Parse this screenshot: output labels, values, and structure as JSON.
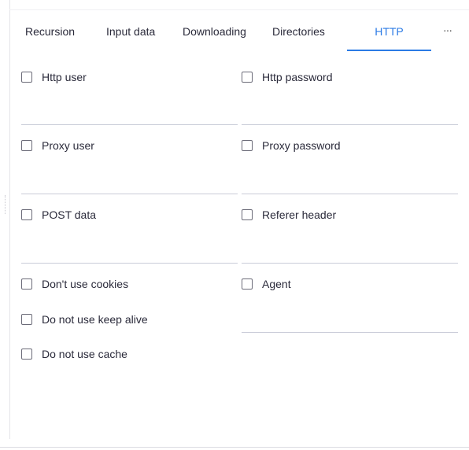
{
  "tabs": [
    {
      "label": "Recursion"
    },
    {
      "label": "Input data"
    },
    {
      "label": "Downloading"
    },
    {
      "label": "Directories"
    },
    {
      "label": "HTTP",
      "active": true
    }
  ],
  "tabs_more": "···",
  "fields": {
    "http_user": {
      "label": "Http user",
      "value": ""
    },
    "http_password": {
      "label": "Http password",
      "value": ""
    },
    "proxy_user": {
      "label": "Proxy user",
      "value": ""
    },
    "proxy_password": {
      "label": "Proxy password",
      "value": ""
    },
    "post_data": {
      "label": "POST data",
      "value": ""
    },
    "referer_header": {
      "label": "Referer header",
      "value": ""
    },
    "agent": {
      "label": "Agent",
      "value": ""
    }
  },
  "options": {
    "dont_use_cookies": {
      "label": "Don't use cookies",
      "checked": false
    },
    "no_keep_alive": {
      "label": "Do not use keep alive",
      "checked": false
    },
    "no_cache": {
      "label": "Do not use cache",
      "checked": false
    }
  },
  "colors": {
    "accent": "#2c7be5",
    "text": "#2a2a3a",
    "underline": "#c9ccd8"
  }
}
